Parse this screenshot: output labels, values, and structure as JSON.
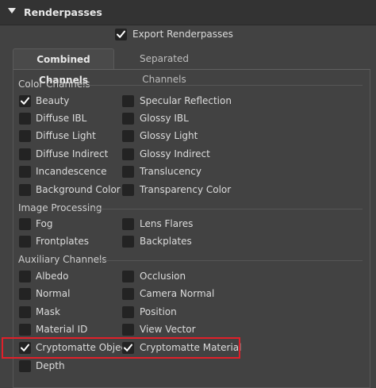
{
  "header": {
    "title": "Renderpasses",
    "arrow_icon": "triangle-down-icon"
  },
  "export": {
    "label": "Export Renderpasses",
    "checked": true
  },
  "tabs": [
    {
      "label": "Combined Channels",
      "active": true
    },
    {
      "label": "Separated Channels",
      "active": false
    }
  ],
  "groups": {
    "color": {
      "title": "Color Channels",
      "items": [
        {
          "label": "Beauty",
          "checked": true
        },
        {
          "label": "Specular Reflection",
          "checked": false
        },
        {
          "label": "Diffuse IBL",
          "checked": false
        },
        {
          "label": "Glossy IBL",
          "checked": false
        },
        {
          "label": "Diffuse Light",
          "checked": false
        },
        {
          "label": "Glossy Light",
          "checked": false
        },
        {
          "label": "Diffuse Indirect",
          "checked": false
        },
        {
          "label": "Glossy Indirect",
          "checked": false
        },
        {
          "label": "Incandescence",
          "checked": false
        },
        {
          "label": "Translucency",
          "checked": false
        },
        {
          "label": "Background Color",
          "checked": false
        },
        {
          "label": "Transparency Color",
          "checked": false
        }
      ]
    },
    "image": {
      "title": "Image Processing",
      "items": [
        {
          "label": "Fog",
          "checked": false
        },
        {
          "label": "Lens Flares",
          "checked": false
        },
        {
          "label": "Frontplates",
          "checked": false
        },
        {
          "label": "Backplates",
          "checked": false
        }
      ]
    },
    "aux": {
      "title": "Auxiliary Channels",
      "items": [
        {
          "label": "Albedo",
          "checked": false
        },
        {
          "label": "Occlusion",
          "checked": false
        },
        {
          "label": "Normal",
          "checked": false
        },
        {
          "label": "Camera Normal",
          "checked": false
        },
        {
          "label": "Mask",
          "checked": false
        },
        {
          "label": "Position",
          "checked": false
        },
        {
          "label": "Material ID",
          "checked": false
        },
        {
          "label": "View Vector",
          "checked": false
        },
        {
          "label": "Cryptomatte Object",
          "checked": true
        },
        {
          "label": "Cryptomatte Material",
          "checked": true
        },
        {
          "label": "Depth",
          "checked": false
        }
      ]
    }
  },
  "colors": {
    "highlight": "#e0202a",
    "check": "#ffffff"
  }
}
